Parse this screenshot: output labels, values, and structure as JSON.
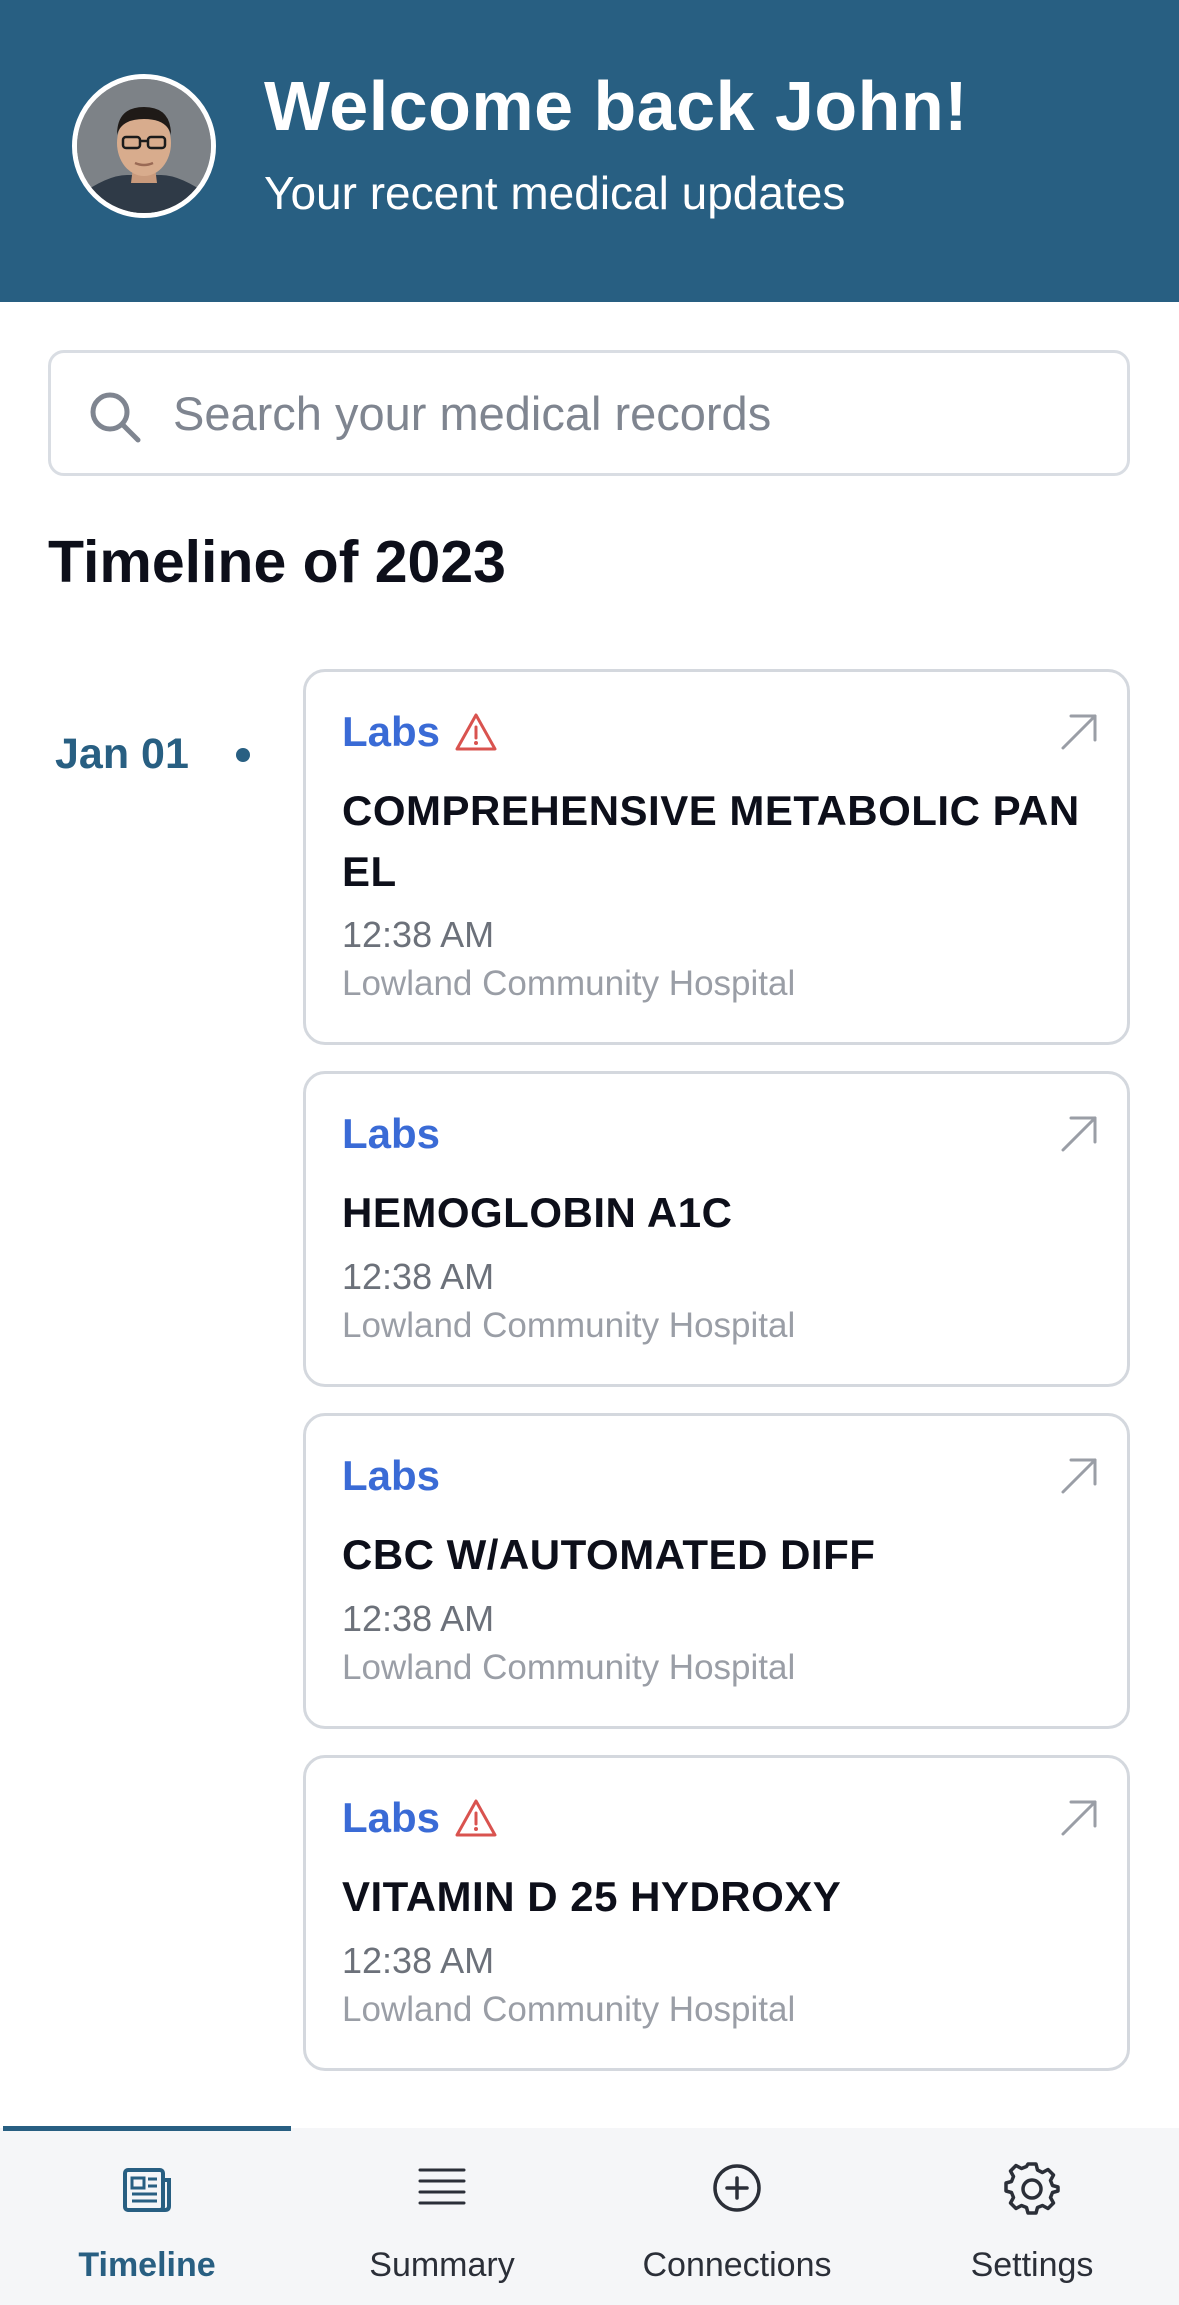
{
  "header": {
    "welcome": "Welcome back John!",
    "subtitle": "Your recent medical updates"
  },
  "search": {
    "placeholder": "Search your medical records",
    "value": ""
  },
  "timeline": {
    "title": "Timeline of 2023",
    "date": "Jan 01",
    "entries": [
      {
        "category": "Labs",
        "warning": true,
        "title": "COMPREHENSIVE METABOLIC PANEL",
        "time": "12:38 AM",
        "location": "Lowland Community Hospital"
      },
      {
        "category": "Labs",
        "warning": false,
        "title": "HEMOGLOBIN A1C",
        "time": "12:38 AM",
        "location": "Lowland Community Hospital"
      },
      {
        "category": "Labs",
        "warning": false,
        "title": "CBC W/AUTOMATED DIFF",
        "time": "12:38 AM",
        "location": "Lowland Community Hospital"
      },
      {
        "category": "Labs",
        "warning": true,
        "title": "VITAMIN D 25 HYDROXY",
        "time": "12:38 AM",
        "location": "Lowland Community Hospital"
      }
    ]
  },
  "tabs": [
    {
      "label": "Timeline",
      "icon": "newspaper-icon",
      "active": true
    },
    {
      "label": "Summary",
      "icon": "list-icon",
      "active": false
    },
    {
      "label": "Connections",
      "icon": "plus-circle-icon",
      "active": false
    },
    {
      "label": "Settings",
      "icon": "gear-icon",
      "active": false
    }
  ],
  "colors": {
    "brand": "#285f82",
    "category": "#3a6bd6",
    "warning": "#d9534f"
  }
}
